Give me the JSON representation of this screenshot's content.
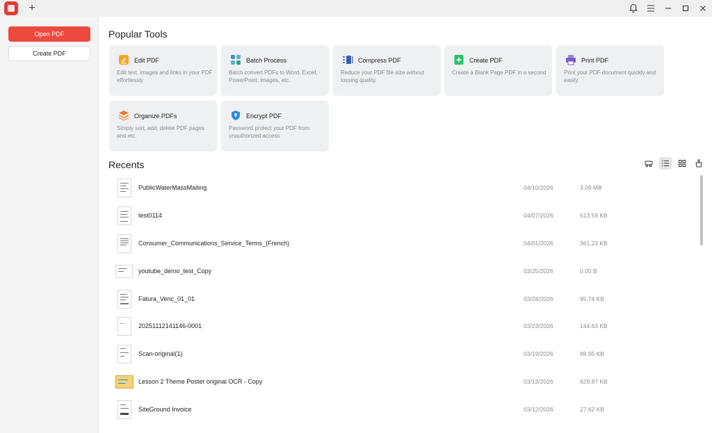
{
  "titlebar": {
    "new_tab_label": "+",
    "icons": [
      "app-logo-icon",
      "bell-icon",
      "menu-icon",
      "minimize-icon",
      "maximize-icon",
      "close-icon"
    ]
  },
  "sidebar": {
    "open_pdf": "Open PDF",
    "create_pdf": "Create PDF"
  },
  "popular_tools": {
    "title": "Popular Tools",
    "tools": [
      {
        "name": "Edit PDF",
        "desc": "Edit text, images and links in your PDF effortlessly",
        "icon": "edit-pdf-icon",
        "color": "#f5a623"
      },
      {
        "name": "Batch Process",
        "desc": "Batch convert PDFs to Word, Excel, PowerPoint, images, etc.",
        "icon": "batch-process-icon",
        "color": "#4a90c2"
      },
      {
        "name": "Compress PDF",
        "desc": "Reduce your PDF file size without lossing quality.",
        "icon": "compress-pdf-icon",
        "color": "#3a5fb8"
      },
      {
        "name": "Create PDF",
        "desc": "Create a Blank Page PDF in a second",
        "icon": "create-pdf-icon",
        "color": "#27c46b"
      },
      {
        "name": "Print PDF",
        "desc": "Print your PDF document quickly and easily",
        "icon": "print-pdf-icon",
        "color": "#7a5cc8"
      },
      {
        "name": "Organize PDFs",
        "desc": "Simply sort, add, delete PDF pages and etc.",
        "icon": "organize-pdfs-icon",
        "color": "#f07a2a"
      },
      {
        "name": "Encrypt PDF",
        "desc": "Password protect your PDF from unauthorized access",
        "icon": "encrypt-pdf-icon",
        "color": "#2d8cd8"
      }
    ]
  },
  "recents": {
    "title": "Recents",
    "view_icons": [
      "search-view-icon",
      "list-view-icon",
      "grid-view-icon",
      "clear-icon"
    ],
    "active_view": "list",
    "files": [
      {
        "name": "PublicWaterMassMailing",
        "date": "04/10/2026",
        "size": "3.09 MB"
      },
      {
        "name": "test0114",
        "date": "04/07/2026",
        "size": "513.59 KB"
      },
      {
        "name": "Consumer_Communications_Service_Terms_(French)",
        "date": "04/01/2026",
        "size": "361.23 KB"
      },
      {
        "name": "youtube_demo_test_Copy",
        "date": "03/25/2026",
        "size": "0.00 B"
      },
      {
        "name": "Fatura_Venc_01_01",
        "date": "03/24/2026",
        "size": "95.74 KB"
      },
      {
        "name": "20251112141146-0001",
        "date": "03/23/2026",
        "size": "144.63 KB"
      },
      {
        "name": "Scan-original(1)",
        "date": "03/19/2026",
        "size": "88.95 KB"
      },
      {
        "name": "Lesson 2 Theme Poster original OCR - Copy",
        "date": "03/13/2026",
        "size": "629.87 KB"
      },
      {
        "name": "SiteGround Invoice",
        "date": "03/12/2026",
        "size": "27.62 KB"
      }
    ]
  },
  "colors": {
    "accent": "#ec4a3f",
    "sidebar_bg": "#f4f4f5",
    "card_bg": "#eff0f2"
  }
}
